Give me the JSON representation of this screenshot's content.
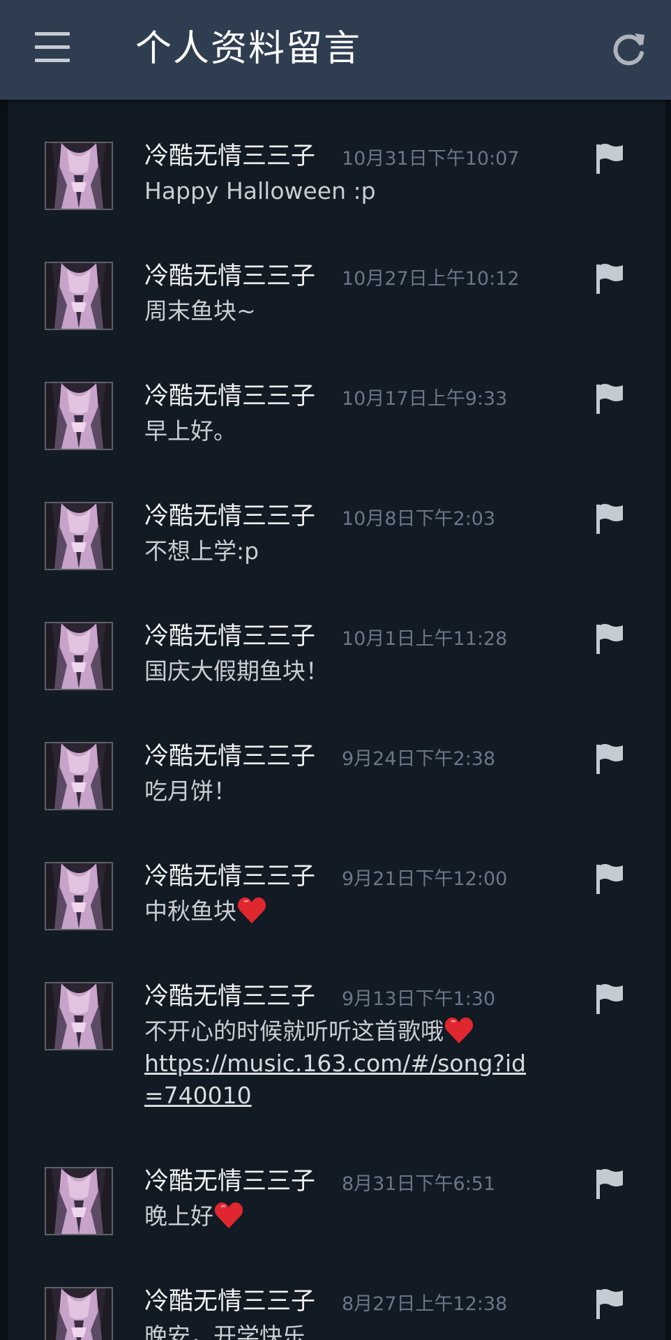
{
  "header": {
    "title": "个人资料留言",
    "menu_icon": "hamburger-icon",
    "refresh_icon": "refresh-icon"
  },
  "colors": {
    "header_bg": "#2f3d51",
    "panel_bg": "#121a24",
    "page_bg": "#0b1016",
    "author": "#f1f1f1",
    "timestamp": "#6b7787",
    "heart": "#e0262f"
  },
  "comments": [
    {
      "author": "冷酷无情三三子",
      "time": "10月31日下午10:07",
      "text": "Happy Halloween :p"
    },
    {
      "author": "冷酷无情三三子",
      "time": "10月27日上午10:12",
      "text": "周末鱼块~"
    },
    {
      "author": "冷酷无情三三子",
      "time": "10月17日上午9:33",
      "text": "早上好。"
    },
    {
      "author": "冷酷无情三三子",
      "time": "10月8日下午2:03",
      "text": "不想上学:p"
    },
    {
      "author": "冷酷无情三三子",
      "time": "10月1日上午11:28",
      "text": "国庆大假期鱼块！"
    },
    {
      "author": "冷酷无情三三子",
      "time": "9月24日下午2:38",
      "text": "吃月饼！"
    },
    {
      "author": "冷酷无情三三子",
      "time": "9月21日下午12:00",
      "text": "中秋鱼块"
    },
    {
      "author": "冷酷无情三三子",
      "time": "9月13日下午1:30",
      "text": "不开心的时候就听听这首歌哦",
      "link": "https://music.163.com/#/song?id=740010"
    },
    {
      "author": "冷酷无情三三子",
      "time": "8月31日下午6:51",
      "text": "晚上好"
    },
    {
      "author": "冷酷无情三三子",
      "time": "8月27日上午12:38",
      "text": "晚安，开学快乐"
    }
  ]
}
